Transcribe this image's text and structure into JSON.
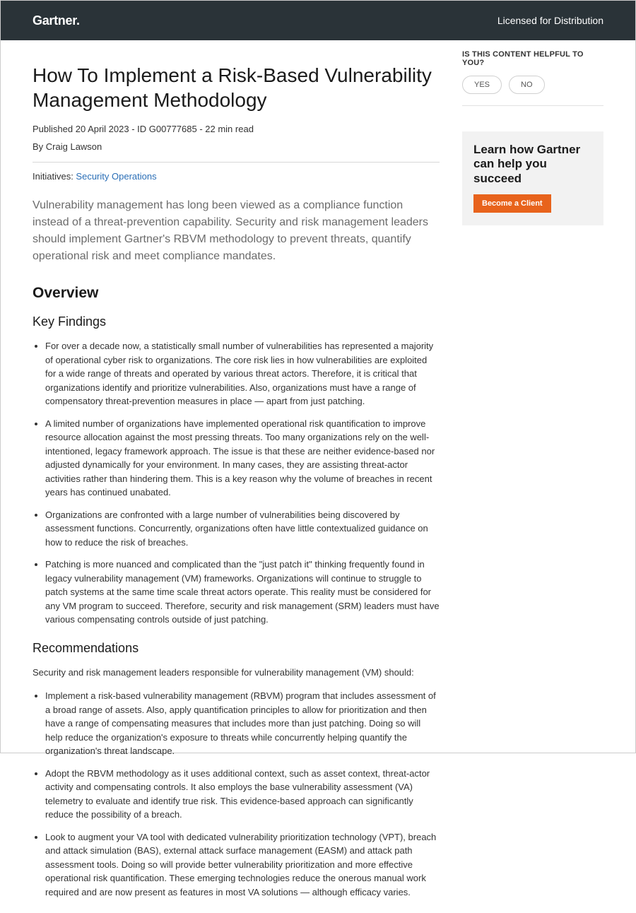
{
  "topbar": {
    "brand": "Gartner",
    "brand_suffix": ".",
    "licensed": "Licensed for Distribution"
  },
  "article": {
    "title": "How To Implement a Risk-Based Vulnerability Management Methodology",
    "meta": "Published 20 April 2023 - ID G00777685 - 22 min read",
    "author": "By Craig Lawson",
    "initiatives_label": "Initiatives: ",
    "initiatives_link": "Security Operations",
    "summary": "Vulnerability management has long been viewed as a compliance function instead of a threat-prevention capability. Security and risk management leaders should implement Gartner's RBVM methodology to prevent threats, quantify operational risk and meet compliance mandates.",
    "overview_heading": "Overview",
    "key_findings_heading": "Key Findings",
    "key_findings": [
      "For over a decade now, a statistically small number of vulnerabilities has represented a majority of operational cyber risk to organizations. The core risk lies in how vulnerabilities are exploited for a wide range of threats and operated by various threat actors. Therefore, it is critical that organizations identify and prioritize vulnerabilities. Also, organizations must have a range of compensatory threat-prevention measures in place — apart from just patching.",
      "A limited number of organizations have implemented operational risk quantification to improve resource allocation against the most pressing threats. Too many organizations rely on the well-intentioned, legacy framework approach. The issue is that these are neither evidence-based nor adjusted dynamically for your environment. In many cases, they are assisting threat-actor activities rather than hindering them. This is a key reason why the volume of breaches in recent years has continued unabated.",
      "Organizations are confronted with a large number of vulnerabilities being discovered by assessment functions. Concurrently, organizations often have little contextualized guidance on how to reduce the risk of breaches.",
      "Patching is more nuanced and complicated than the \"just patch it\" thinking frequently found in legacy vulnerability management (VM) frameworks. Organizations will continue to struggle to patch systems at the same time scale threat actors operate. This reality must be considered for any VM program to succeed. Therefore, security and risk management (SRM) leaders must have various compensating controls outside of just patching."
    ],
    "recommendations_heading": "Recommendations",
    "recommendations_lead": "Security and risk management leaders responsible for vulnerability management (VM) should:",
    "recommendations": [
      "Implement a risk-based vulnerability management (RBVM) program that includes assessment of a broad range of assets. Also, apply quantification principles to allow for prioritization and then have a range of compensating measures that includes more than just patching. Doing so will help reduce the organization's exposure to threats while concurrently helping quantify the organization's threat landscape.",
      "Adopt the RBVM methodology as it uses additional context, such as asset context, threat-actor activity and compensating controls. It also employs the base vulnerability assessment (VA) telemetry to evaluate and identify true risk. This evidence-based approach can significantly reduce the possibility of a breach.",
      "Look to augment your VA tool with dedicated vulnerability prioritization technology (VPT), breach and attack simulation (BAS), external attack surface management (EASM) and attack path assessment tools. Doing so will provide better vulnerability prioritization and more effective operational risk quantification. These emerging technologies reduce the onerous manual work required and are now present as features in most VA solutions — although efficacy varies."
    ]
  },
  "sidebar": {
    "helpful_label": "IS THIS CONTENT HELPFUL TO YOU?",
    "yes": "YES",
    "no": "NO",
    "promo_title": "Learn how Gartner can help you succeed",
    "promo_cta": "Become a Client"
  }
}
